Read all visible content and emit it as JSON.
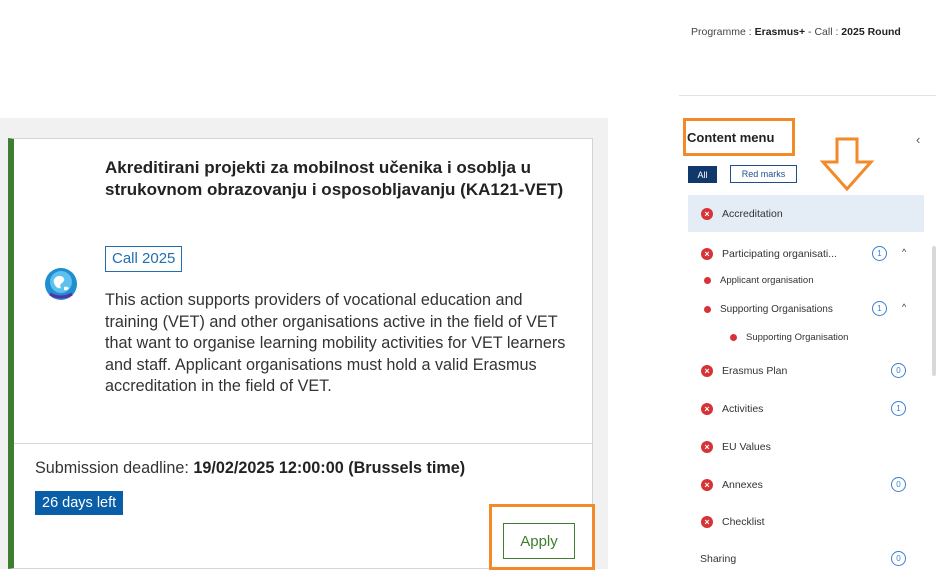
{
  "card": {
    "title": "Akreditirani projekti za mobilnost učenika i osoblja u strukovnom obrazovanju i osposobljavanju (KA121-VET)",
    "call_badge": "Call 2025",
    "description": "This action supports providers of vocational education and training (VET) and other organisations active in the field of VET that want to organise learning mobility activities for VET learners and staff. Applicant organisations must hold a valid Erasmus accreditation in the field of VET.",
    "deadline_label": "Submission deadline:",
    "deadline_value": "19/02/2025 12:00:00 (Brussels time)",
    "days_left": "26 days left",
    "apply_label": "Apply",
    "accent_color": "#3d7e2f"
  },
  "programme": {
    "label": "Programme :",
    "name": "Erasmus+",
    "call_label": "- Call :",
    "call_value": "2025 Round"
  },
  "content_menu": {
    "title": "Content menu",
    "filter_all": "All",
    "filter_red": "Red marks",
    "items": [
      {
        "label": "Accreditation"
      },
      {
        "label": "Participating organisati...",
        "count": "1"
      },
      {
        "label": "Applicant organisation"
      },
      {
        "label": "Supporting Organisations",
        "count": "1"
      },
      {
        "label": "Supporting Organisation"
      },
      {
        "label": "Erasmus Plan",
        "count": "0"
      },
      {
        "label": "Activities",
        "count": "1"
      },
      {
        "label": "EU Values"
      },
      {
        "label": "Annexes",
        "count": "0"
      },
      {
        "label": "Checklist"
      },
      {
        "label": "Sharing",
        "count": "0"
      }
    ]
  },
  "highlight_color": "#f28a2a"
}
